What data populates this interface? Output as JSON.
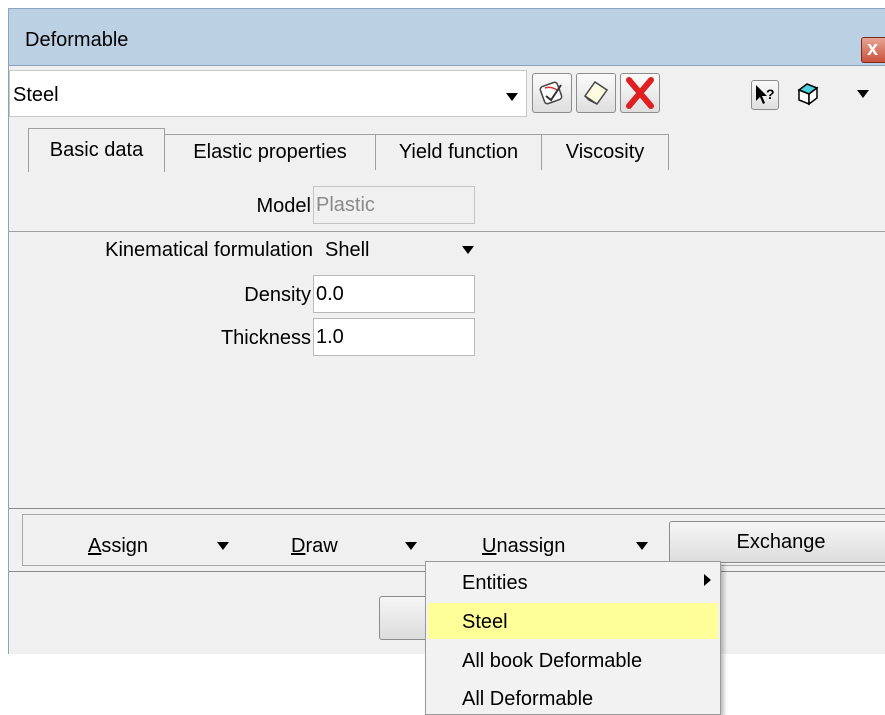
{
  "window": {
    "title": "Deformable",
    "close_glyph": "x"
  },
  "toolbar": {
    "material": "Steel",
    "icons": [
      "edit-icon",
      "new-icon",
      "delete-icon",
      "help-pointer-icon",
      "book-icon",
      "chevron-down-icon"
    ]
  },
  "tabs": [
    {
      "label": "Basic data",
      "active": true
    },
    {
      "label": "Elastic properties",
      "active": false
    },
    {
      "label": "Yield function",
      "active": false
    },
    {
      "label": "Viscosity",
      "active": false
    }
  ],
  "form": {
    "model_label": "Model",
    "model_value": "Plastic",
    "kinematical_label": "Kinematical formulation",
    "kinematical_value": "Shell",
    "density_label": "Density",
    "density_value": "0.0",
    "thickness_label": "Thickness",
    "thickness_value": "1.0"
  },
  "actions": {
    "assign_first": "A",
    "assign_rest": "ssign",
    "draw_first": "D",
    "draw_rest": "raw",
    "unassign_first": "U",
    "unassign_rest": "nassign",
    "exchange": "Exchange"
  },
  "popup_menu": {
    "items": [
      "Entities",
      "Steel",
      "All book Deformable",
      "All Deformable"
    ],
    "highlighted": "Steel",
    "highlight_color": "#ffff99"
  },
  "colors": {
    "title_bar": "#bcd0e4",
    "close_button": "#c9523b"
  }
}
